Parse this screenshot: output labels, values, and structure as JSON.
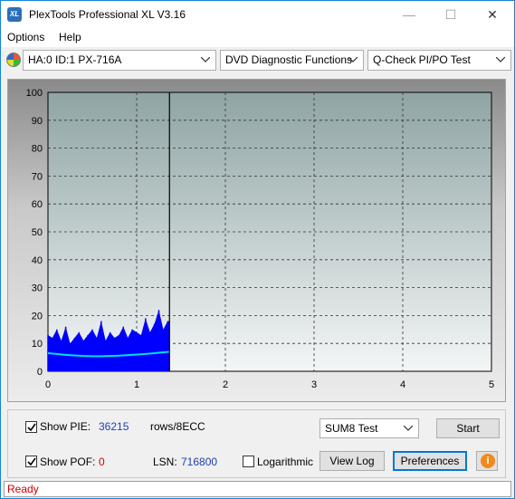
{
  "window": {
    "title": "PlexTools Professional XL V3.16",
    "icon_text": "XL",
    "minimize": "—",
    "maximize": "☐",
    "close": "✕"
  },
  "menu": {
    "options": "Options",
    "help": "Help"
  },
  "toolbar": {
    "drive": "HA:0 ID:1  PX-716A",
    "function": "DVD Diagnostic Functions",
    "test": "Q-Check PI/PO Test"
  },
  "chart_data": {
    "type": "area",
    "xlim": [
      0,
      5
    ],
    "ylim": [
      0,
      100
    ],
    "x_ticks": [
      "0",
      "1",
      "2",
      "3",
      "4",
      "5"
    ],
    "y_ticks": [
      "0",
      "10",
      "20",
      "30",
      "40",
      "50",
      "60",
      "70",
      "80",
      "90",
      "100"
    ],
    "grid": true,
    "marker_x": 1.37,
    "series": [
      {
        "color": "#0000ff",
        "x": [
          0,
          0.05,
          0.1,
          0.15,
          0.2,
          0.25,
          0.3,
          0.35,
          0.4,
          0.45,
          0.5,
          0.55,
          0.6,
          0.65,
          0.7,
          0.75,
          0.8,
          0.85,
          0.9,
          0.95,
          1.0,
          1.05,
          1.1,
          1.15,
          1.2,
          1.25,
          1.3,
          1.35
        ],
        "y": [
          13,
          12,
          15,
          11,
          16,
          10,
          12,
          14,
          11,
          13,
          15,
          12,
          18,
          11,
          14,
          12,
          13,
          16,
          12,
          15,
          14,
          13,
          19,
          14,
          17,
          22,
          15,
          18
        ]
      },
      {
        "color": "#00e0f0",
        "x": [
          0,
          0.1,
          0.2,
          0.3,
          0.4,
          0.5,
          0.6,
          0.7,
          0.8,
          0.9,
          1.0,
          1.1,
          1.2,
          1.3,
          1.37
        ],
        "y": [
          6.5,
          6.2,
          5.9,
          5.7,
          5.5,
          5.4,
          5.4,
          5.5,
          5.6,
          5.8,
          6.0,
          6.2,
          6.5,
          6.8,
          7.0
        ]
      }
    ]
  },
  "controls": {
    "show_pie_label": "Show PIE:",
    "pie_value": "36215",
    "pie_unit": "rows/8ECC",
    "show_pof_label": "Show POF:",
    "pof_value": "0",
    "lsn_label": "LSN:",
    "lsn_value": "716800",
    "logarithmic_label": "Logarithmic",
    "test_select": "SUM8 Test",
    "start": "Start",
    "view_log": "View Log",
    "preferences": "Preferences",
    "info": "i"
  },
  "status": {
    "text": "Ready"
  }
}
